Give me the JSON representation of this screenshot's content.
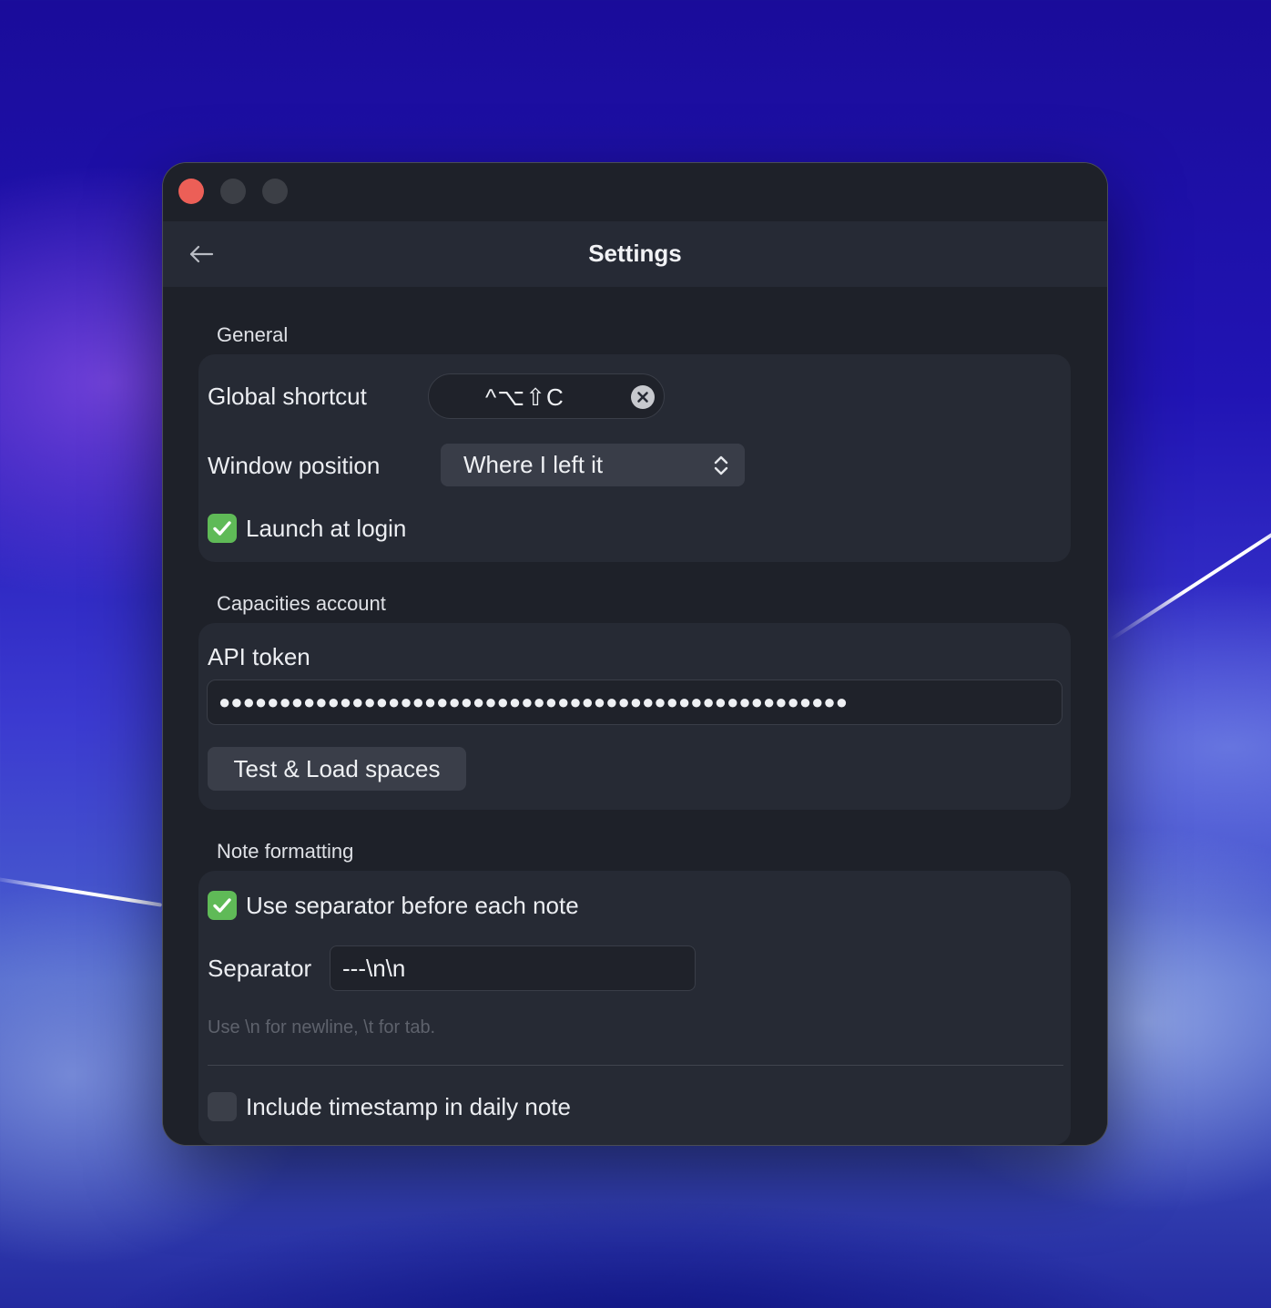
{
  "window": {
    "title": "Settings"
  },
  "sections": {
    "general": {
      "title": "General",
      "global_shortcut_label": "Global shortcut",
      "global_shortcut_value": "^⌥⇧C",
      "window_position_label": "Window position",
      "window_position_value": "Where I left it",
      "launch_at_login_label": "Launch at login",
      "launch_at_login_checked": true
    },
    "account": {
      "title": "Capacities account",
      "api_token_label": "API token",
      "api_token_value": "●●●●●●●●●●●●●●●●●●●●●●●●●●●●●●●●●●●●●●●●●●●●●●●●●●●●",
      "test_button_label": "Test & Load spaces"
    },
    "formatting": {
      "title": "Note formatting",
      "use_separator_label": "Use separator before each note",
      "use_separator_checked": true,
      "separator_label": "Separator",
      "separator_value": "---\\n\\n",
      "separator_hint": "Use \\n for newline, \\t for tab.",
      "timestamp_label": "Include timestamp in daily note",
      "timestamp_checked": false
    }
  },
  "icons": {
    "back": "arrow-left-icon",
    "clear": "clear-circle-icon",
    "select_chevrons": "up-down-chevron-icon",
    "check": "checkmark-icon"
  },
  "colors": {
    "checkbox_on": "#5fba57",
    "close_light": "#ec5f57",
    "window_bg": "#1e2129",
    "card_bg": "#262a34"
  }
}
